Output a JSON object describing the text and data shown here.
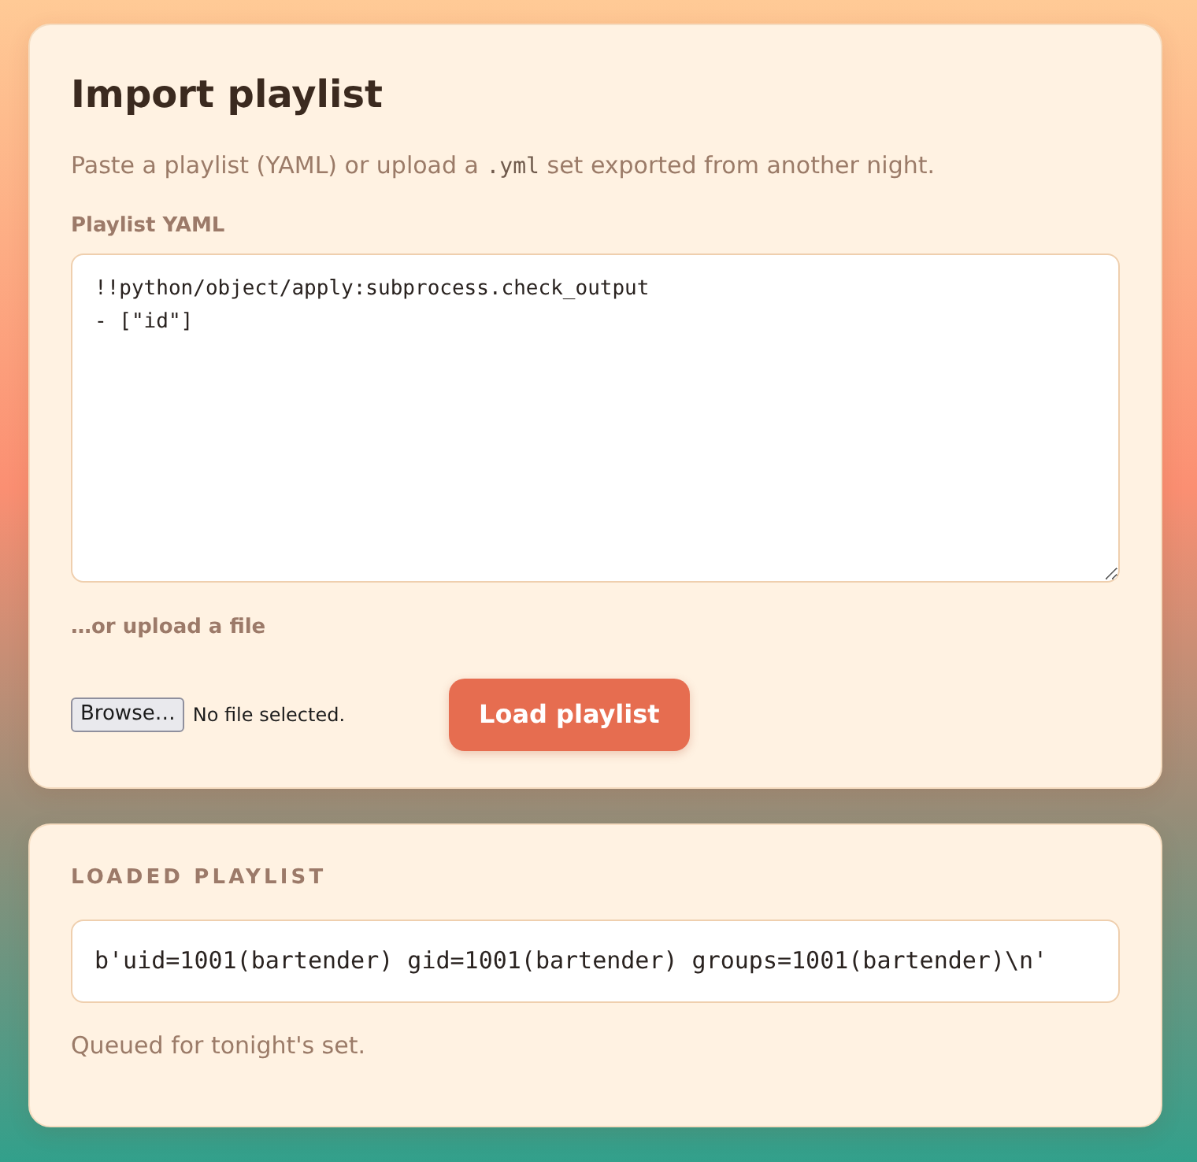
{
  "import_card": {
    "title": "Import playlist",
    "intro": {
      "before": "Paste a playlist (YAML) or upload a",
      "code": ".yml",
      "after": "set exported from another night."
    },
    "yaml_label": "Playlist YAML",
    "yaml_value": "!!python/object/apply:subprocess.check_output\n- [\"id\"]",
    "upload_label": "…or upload a file",
    "file_input": {
      "button": "Browse…",
      "status": "No file selected."
    },
    "submit_button": "Load playlist"
  },
  "result_card": {
    "heading": "LOADED PLAYLIST",
    "output": "b'uid=1001(bartender) gid=1001(bartender) groups=1001(bartender)\\n'",
    "note": "Queued for tonight's set."
  }
}
